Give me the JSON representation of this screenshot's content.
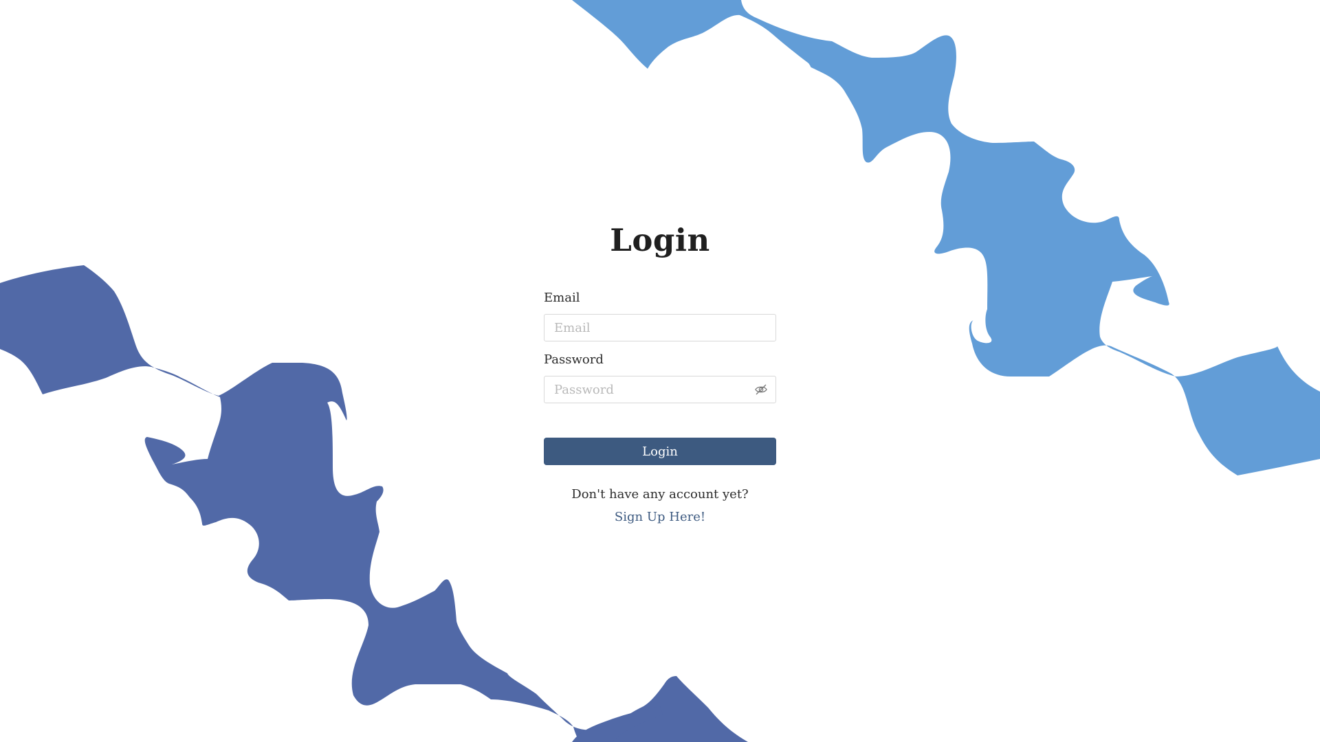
{
  "colors": {
    "wave_light": "#629dd7",
    "wave_dark": "#5169a7",
    "button": "#3d5a80",
    "link": "#3d5a80"
  },
  "login": {
    "title": "Login",
    "email_label": "Email",
    "email_placeholder": "Email",
    "password_label": "Password",
    "password_placeholder": "Password",
    "toggle_icon": "eye-slash-icon",
    "submit_label": "Login",
    "no_account_text": "Don't have any account yet?",
    "signup_link": "Sign Up Here!"
  }
}
